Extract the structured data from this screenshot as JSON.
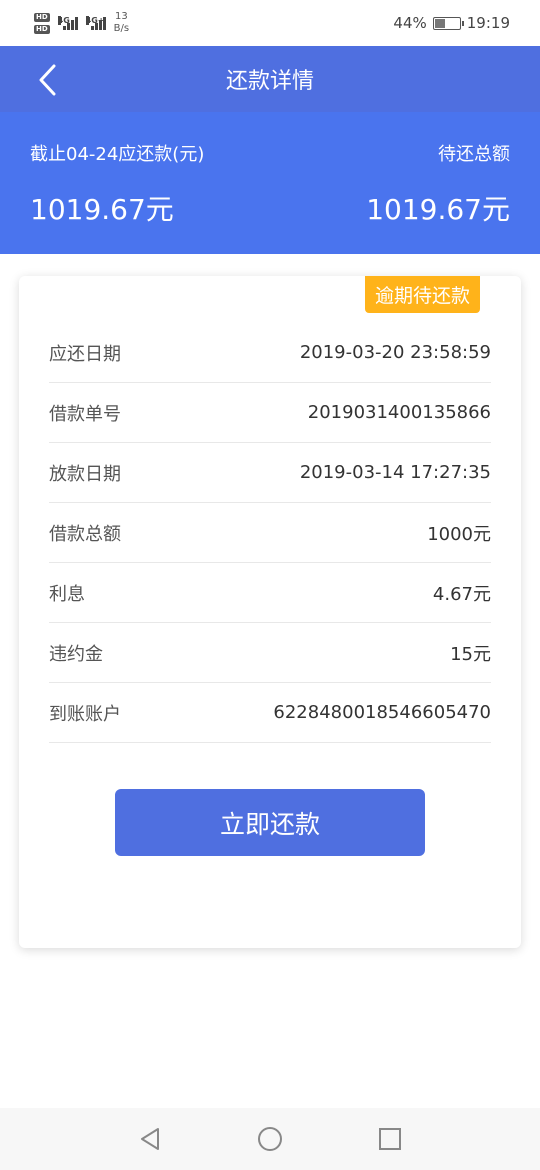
{
  "status_bar": {
    "hd1": "HD",
    "hd2": "HD",
    "net1": "4G",
    "net2": "4G+",
    "speed_value": "13",
    "speed_unit": "B/s",
    "battery": "44%",
    "battery_level": 0.44,
    "time": "19:19"
  },
  "header": {
    "title": "还款详情"
  },
  "summary": {
    "due_label": "截止04-24应还款(元)",
    "due_amount": "1019.67元",
    "total_label": "待还总额",
    "total_amount": "1019.67元"
  },
  "card": {
    "badge": "逾期待还款",
    "rows": [
      {
        "label": "应还日期",
        "value": "2019-03-20 23:58:59"
      },
      {
        "label": "借款单号",
        "value": "2019031400135866"
      },
      {
        "label": "放款日期",
        "value": "2019-03-14 17:27:35"
      },
      {
        "label": "借款总额",
        "value": "1000元"
      },
      {
        "label": "利息",
        "value": "4.67元"
      },
      {
        "label": "违约金",
        "value": "15元"
      },
      {
        "label": "到账账户",
        "value": "6228480018546605470"
      }
    ],
    "repay_button": "立即还款"
  },
  "colors": {
    "nav": "#4f6fe0",
    "summary": "#4a74ee",
    "badge": "#ffb31a",
    "button": "#4f6fe0"
  }
}
